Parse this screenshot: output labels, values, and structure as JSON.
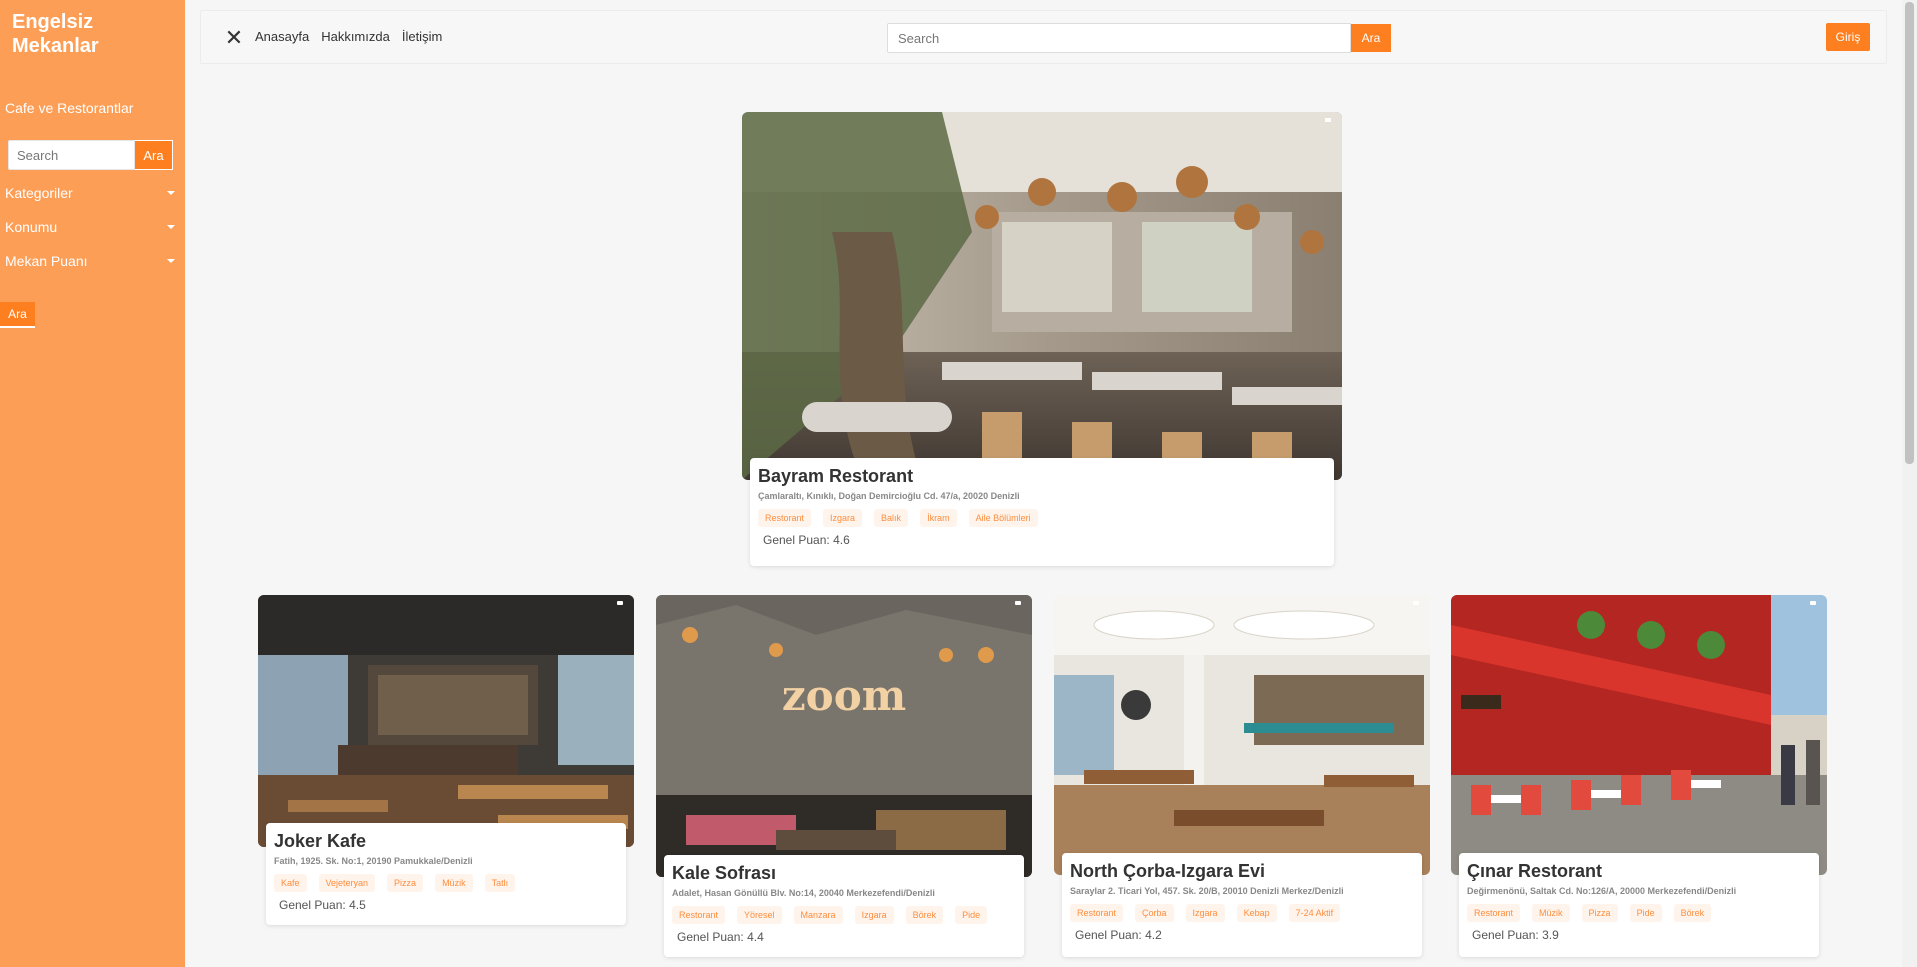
{
  "sidebar": {
    "brand": "Engelsiz Mekanlar",
    "heading": "Cafe ve Restorantlar",
    "search_placeholder": "Search",
    "search_button": "Ara",
    "menu": [
      "Kategoriler",
      "Konumu",
      "Mekan Puanı"
    ],
    "submit_button": "Ara"
  },
  "topbar": {
    "nav": [
      "Anasayfa",
      "Hakkımızda",
      "İletişim"
    ],
    "search_placeholder": "Search",
    "search_button": "Ara",
    "login_button": "Giriş"
  },
  "score_label": "Genel Puan:",
  "featured": {
    "name": "Bayram Restorant",
    "address": "Çamlaraltı, Kınıklı, Doğan Demircioğlu Cd. 47/a, 20020 Denizli",
    "tags": [
      "Restorant",
      "Izgara",
      "Balık",
      "İkram",
      "Aile Bölümleri"
    ],
    "score": "4.6"
  },
  "places": [
    {
      "name": "Joker Kafe",
      "address": "Fatih, 1925. Sk. No:1, 20190 Pamukkale/Denizli",
      "tags": [
        "Kafe",
        "Vejeteryan",
        "Pizza",
        "Müzik",
        "Tatlı"
      ],
      "score": "4.5"
    },
    {
      "name": "Kale Sofrası",
      "address": "Adalet, Hasan Gönüllü Blv. No:14, 20040 Merkezefendi/Denizli",
      "tags": [
        "Restorant",
        "Yöresel",
        "Manzara",
        "Izgara",
        "Börek",
        "Pide"
      ],
      "score": "4.4"
    },
    {
      "name": "North Çorba-Izgara Evi",
      "address": "Saraylar 2. Ticari Yol, 457. Sk. 20/B, 20010 Denizli Merkez/Denizli",
      "tags": [
        "Restorant",
        "Çorba",
        "Izgara",
        "Kebap",
        "7-24 Aktif"
      ],
      "score": "4.2"
    },
    {
      "name": "Çınar Restorant",
      "address": "Değirmenönü, Saltak Cd. No:126/A, 20000 Merkezefendi/Denizli",
      "tags": [
        "Restorant",
        "Müzik",
        "Pizza",
        "Pide",
        "Börek"
      ],
      "score": "3.9"
    }
  ],
  "images": {
    "featured": "restaurant-interior-photo",
    "places": [
      "cafe-interior-photo",
      "restaurant-zoom-wall-photo",
      "restaurant-dining-hall-photo",
      "street-cafe-red-awning-photo"
    ]
  },
  "colors": {
    "sidebar": "#fd9e56",
    "accent": "#fd7f1f",
    "tag_text": "#fd8e3f"
  }
}
